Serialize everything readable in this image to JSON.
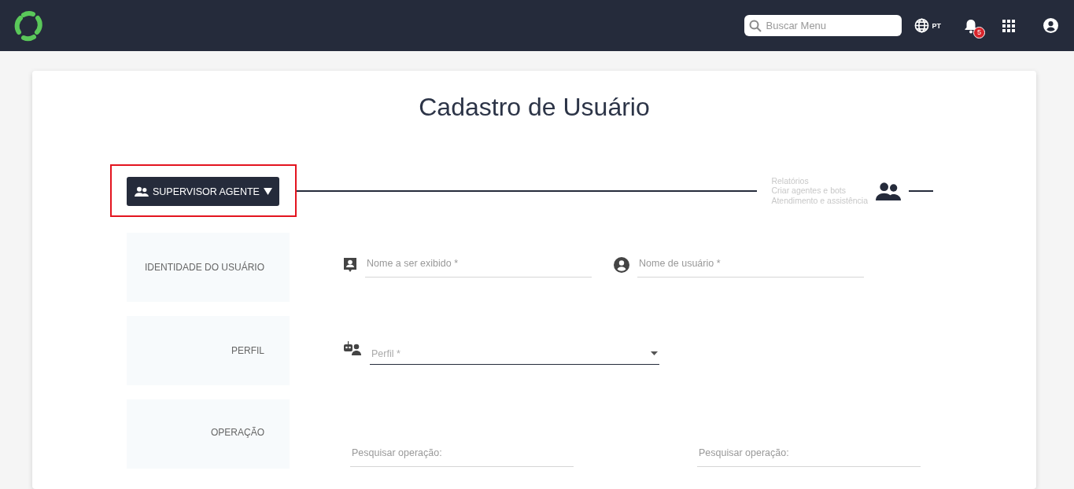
{
  "header": {
    "search": {
      "placeholder": "Buscar Menu"
    },
    "language": "PT",
    "notifications": "5"
  },
  "title": "Cadastro de Usuário",
  "role_selector": {
    "label": "SUPERVISOR AGENTE",
    "highlighted": true
  },
  "permissions": [
    "Relatórios",
    "Criar agentes e bots",
    "Atendimento e assistência"
  ],
  "sections": [
    {
      "label": "IDENTIDADE DO USUÁRIO",
      "fields": [
        {
          "kind": "display_name",
          "placeholder": "Nome a ser exibido *"
        },
        {
          "kind": "username",
          "placeholder": "Nome de usuário *"
        }
      ]
    },
    {
      "label": "PERFIL",
      "fields": [
        {
          "kind": "select",
          "placeholder": "Perfil *"
        }
      ]
    },
    {
      "label": "OPERAÇÃO",
      "fields": [
        {
          "kind": "search",
          "placeholder": "Pesquisar operação:"
        },
        {
          "kind": "search",
          "placeholder": "Pesquisar operação:"
        }
      ]
    }
  ]
}
